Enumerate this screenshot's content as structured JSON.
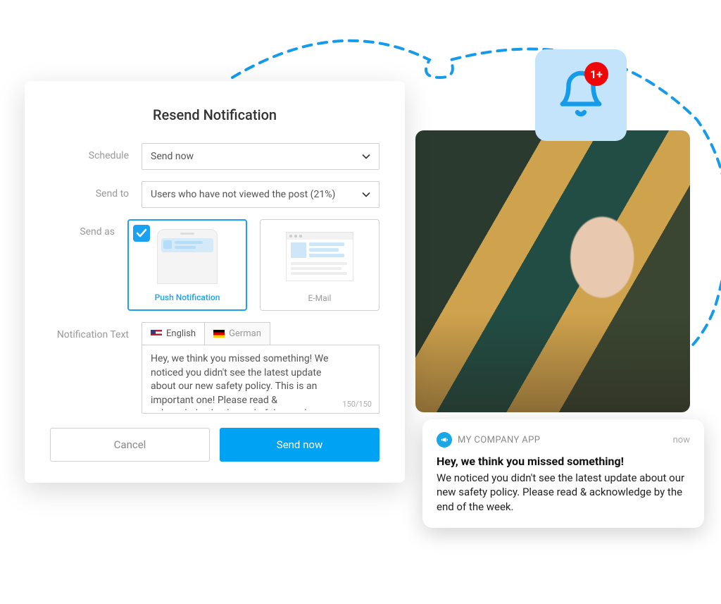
{
  "modal": {
    "title": "Resend Notification",
    "labels": {
      "schedule": "Schedule",
      "send_to": "Send to",
      "send_as": "Send as",
      "notification_text": "Notification Text"
    },
    "schedule_value": "Send now",
    "send_to_value": "Users who have not viewed the post (21%)",
    "send_as": {
      "push_label": "Push Notification",
      "email_label": "E-Mail"
    },
    "lang_tabs": {
      "english": "English",
      "german": "German"
    },
    "textarea_value": "Hey, we think you missed something! We noticed you didn't see the latest update about our new safety policy. This is an important one! Please read & acknowledge by the end of the week.",
    "char_count": "150/150",
    "buttons": {
      "cancel": "Cancel",
      "send": "Send now"
    }
  },
  "bell": {
    "badge": "1+"
  },
  "push_preview": {
    "app_name": "MY COMPANY APP",
    "time": "now",
    "title": "Hey, we think you missed something!",
    "body": "We noticed you didn't see the latest update about our new safety policy. Please read & acknowledge by the end of the week."
  }
}
